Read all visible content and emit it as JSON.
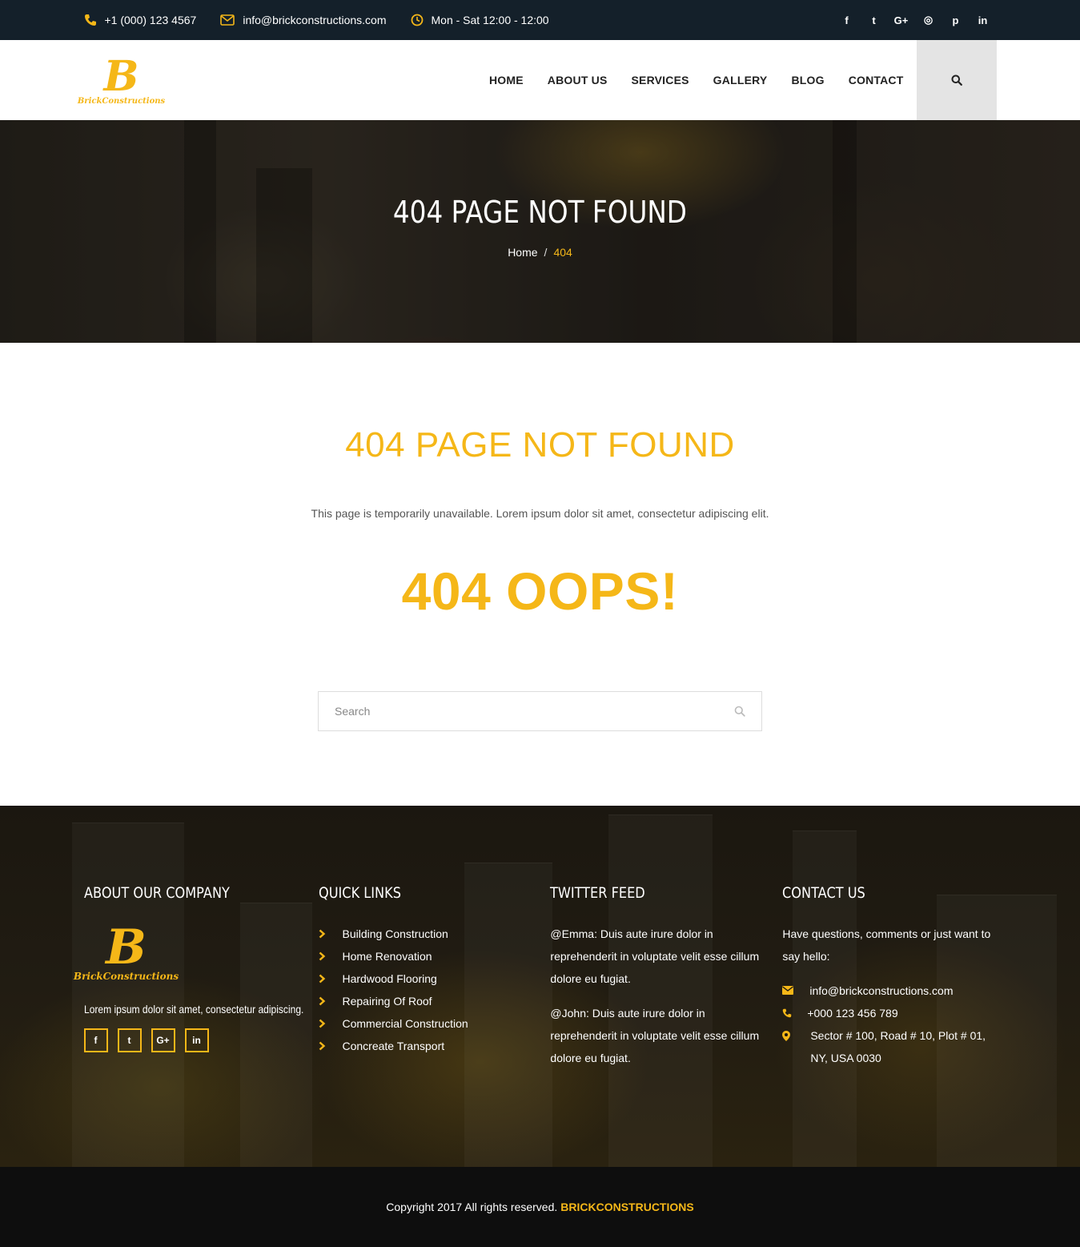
{
  "topbar": {
    "phone": "+1 (000) 123 4567",
    "email": "info@brickconstructions.com",
    "hours": "Mon - Sat 12:00 - 12:00",
    "social": [
      {
        "label": "f",
        "icon": "facebook-icon"
      },
      {
        "label": "t",
        "icon": "twitter-icon"
      },
      {
        "label": "G+",
        "icon": "google-plus-icon"
      },
      {
        "label": "◎",
        "icon": "instagram-icon"
      },
      {
        "label": "p",
        "icon": "pinterest-icon"
      },
      {
        "label": "in",
        "icon": "linkedin-icon"
      }
    ]
  },
  "brand": {
    "monogram": "B",
    "wordmark": "BrickConstructions",
    "accent": "#f5b718",
    "dark": "#14202a"
  },
  "nav": {
    "items": [
      "HOME",
      "ABOUT US",
      "SERVICES",
      "GALLERY",
      "BLOG",
      "CONTACT"
    ],
    "search_icon": "search-icon"
  },
  "banner": {
    "title": "404 PAGE NOT FOUND",
    "breadcrumb": {
      "home": "Home",
      "separator": "/",
      "current": "404"
    }
  },
  "main": {
    "heading": "404 PAGE NOT FOUND",
    "lead": "This page is temporarily unavailable. Lorem ipsum dolor sit amet, consectetur adipiscing elit.",
    "oops": "404 OOPS!",
    "search": {
      "placeholder": "Search",
      "value": ""
    }
  },
  "footer": {
    "about": {
      "title": "ABOUT OUR COMPANY",
      "text": "Lorem ipsum dolor sit amet, consectetur adipiscing.",
      "social": [
        "f",
        "t",
        "G+",
        "in"
      ]
    },
    "quick_links": {
      "title": "QUICK LINKS",
      "items": [
        "Building Construction",
        "Home Renovation",
        "Hardwood Flooring",
        "Repairing Of Roof",
        "Commercial Construction",
        "Concreate Transport"
      ]
    },
    "twitter": {
      "title": "TWITTER FEED",
      "tweets": [
        "@Emma: Duis aute irure dolor in reprehenderit in voluptate velit esse cillum dolore eu fugiat.",
        "@John: Duis aute irure dolor in reprehenderit in voluptate velit esse cillum dolore eu fugiat."
      ]
    },
    "contact": {
      "title": "CONTACT US",
      "intro": "Have questions, comments or just want to say hello:",
      "email": "info@brickconstructions.com",
      "phone": "+000 123 456 789",
      "address": "Sector # 100, Road # 10, Plot # 01, NY, USA 0030"
    }
  },
  "copyright": {
    "text": "Copyright 2017 All rights reserved.",
    "brand": "BRICKCONSTRUCTIONS"
  }
}
